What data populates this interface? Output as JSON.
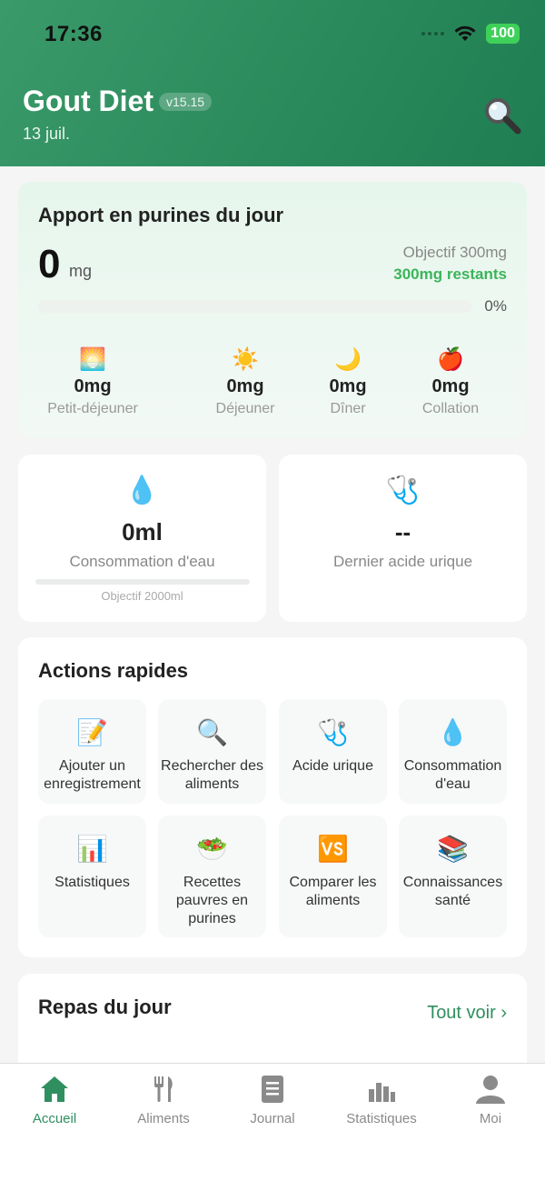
{
  "status_bar": {
    "time": "17:36",
    "battery": "100"
  },
  "header": {
    "title": "Gout Diet",
    "version": "v15.15",
    "date": "13 juil."
  },
  "intake": {
    "title": "Apport en purines du jour",
    "value": "0",
    "unit": "mg",
    "goal": "Objectif 300mg",
    "remaining": "300mg restants",
    "progress_percent": "0%",
    "progress_fraction": 0,
    "meals": [
      {
        "icon": "sunrise-icon",
        "emoji": "🌅",
        "value": "0mg",
        "label": "Petit-déjeuner"
      },
      {
        "icon": "sun-icon",
        "emoji": "☀️",
        "value": "0mg",
        "label": "Déjeuner"
      },
      {
        "icon": "moon-icon",
        "emoji": "🌙",
        "value": "0mg",
        "label": "Dîner"
      },
      {
        "icon": "apple-icon",
        "emoji": "🍎",
        "value": "0mg",
        "label": "Collation"
      }
    ]
  },
  "water": {
    "icon": "water-drop-icon",
    "emoji": "💧",
    "value": "0ml",
    "label": "Consommation d'eau",
    "goal": "Objectif 2000ml",
    "progress_fraction": 0
  },
  "uric_acid": {
    "icon": "stethoscope-icon",
    "emoji": "🩺",
    "value": "--",
    "label": "Dernier acide urique"
  },
  "quick_actions": {
    "title": "Actions rapides",
    "items": [
      {
        "icon": "memo-icon",
        "emoji": "📝",
        "label": "Ajouter un enregistrement"
      },
      {
        "icon": "magnifier-icon",
        "emoji": "🔍",
        "label": "Rechercher des aliments"
      },
      {
        "icon": "stethoscope-icon",
        "emoji": "🩺",
        "label": "Acide urique"
      },
      {
        "icon": "water-drop-icon",
        "emoji": "💧",
        "label": "Consommation d'eau"
      },
      {
        "icon": "bar-chart-icon",
        "emoji": "📊",
        "label": "Statistiques"
      },
      {
        "icon": "salad-icon",
        "emoji": "🥗",
        "label": "Recettes pauvres en purines"
      },
      {
        "icon": "vs-icon",
        "emoji": "🆚",
        "label": "Comparer les aliments"
      },
      {
        "icon": "books-icon",
        "emoji": "📚",
        "label": "Connaissances santé"
      }
    ]
  },
  "meals_today": {
    "title": "Repas du jour",
    "see_all": "Tout voir ›"
  },
  "tabbar": {
    "items": [
      {
        "icon": "home-icon",
        "label": "Accueil",
        "active": true
      },
      {
        "icon": "fork-knife-icon",
        "label": "Aliments",
        "active": false
      },
      {
        "icon": "journal-icon",
        "label": "Journal",
        "active": false
      },
      {
        "icon": "bar-chart-icon",
        "label": "Statistiques",
        "active": false
      },
      {
        "icon": "person-icon",
        "label": "Moi",
        "active": false
      }
    ]
  },
  "colors": {
    "brand_green": "#2f8f5e",
    "remaining_green": "#3cb45a",
    "battery_green": "#3ed15a"
  }
}
